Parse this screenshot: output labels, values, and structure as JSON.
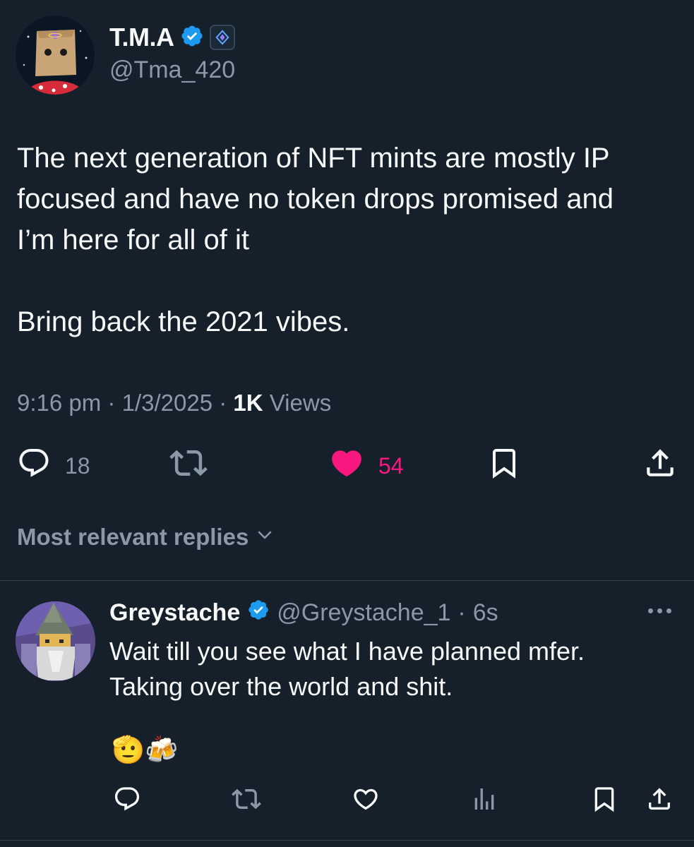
{
  "tweet": {
    "author": {
      "display_name": "T.M.A",
      "handle": "@Tma_420",
      "verified_icon": "verified-badge-icon",
      "extra_badge_icon": "diamond-badge-icon"
    },
    "text_lines": [
      "The next generation of NFT mints are mostly IP",
      "focused and have no token drops promised and",
      "I’m here for all of it"
    ],
    "text_second_paragraph": "Bring back the 2021 vibes.",
    "time": "9:16 pm",
    "separator": "·",
    "date": "1/3/2025",
    "views_count": "1K",
    "views_label": "Views",
    "actions": {
      "reply_count": "18",
      "like_count": "54",
      "reply_icon": "comment-icon",
      "retweet_icon": "retweet-icon",
      "like_icon": "heart-filled-icon",
      "bookmark_icon": "bookmark-icon",
      "share_icon": "share-icon"
    }
  },
  "replies_section": {
    "sort_label": "Most relevant replies",
    "sort_icon": "chevron-down-icon"
  },
  "reply": {
    "display_name": "Greystache",
    "handle": "@Greystache_1",
    "separator": "·",
    "time": "6s",
    "text_lines": [
      "Wait till you see what I have planned mfer.",
      "Taking over the world and shit."
    ],
    "emoji": "🫡🍻",
    "actions": [
      "comment-icon",
      "retweet-icon",
      "heart-icon",
      "analytics-icon",
      "bookmark-icon",
      "share-icon"
    ]
  },
  "colors": {
    "background": "#15202b",
    "text_primary": "#f7f9f9",
    "text_secondary": "#8b98a5",
    "verified_blue": "#1d9bf0",
    "like_pink": "#f91880",
    "divider": "#38444d"
  }
}
